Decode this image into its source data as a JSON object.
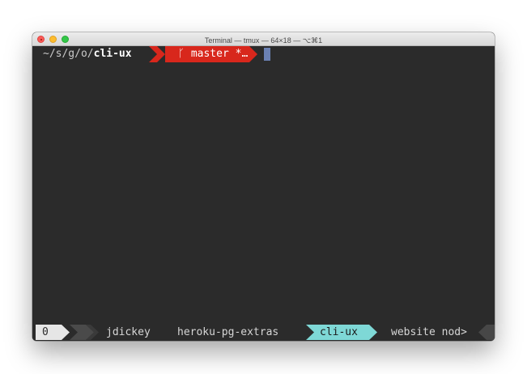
{
  "window": {
    "title": "Terminal — tmux — 64×18 — ⌥⌘1"
  },
  "prompt": {
    "path_prefix": "~/s/g/o/",
    "path_current": "cli-ux",
    "branch_icon": "git-branch-icon",
    "branch_symbol": "ᚴ",
    "branch": "master *…"
  },
  "tmux": {
    "session": "0",
    "windows": [
      {
        "label": "jdickey",
        "active": false
      },
      {
        "label": "heroku-pg-extras",
        "active": false
      },
      {
        "label": "cli-ux",
        "active": true
      },
      {
        "label": "website nod>",
        "active": false
      }
    ]
  },
  "colors": {
    "terminal_bg": "#2b2b2b",
    "git_segment": "#d8271c",
    "active_window": "#7ed8d6",
    "session_bg": "#e6e6e6",
    "cursor": "#6b81b3"
  }
}
